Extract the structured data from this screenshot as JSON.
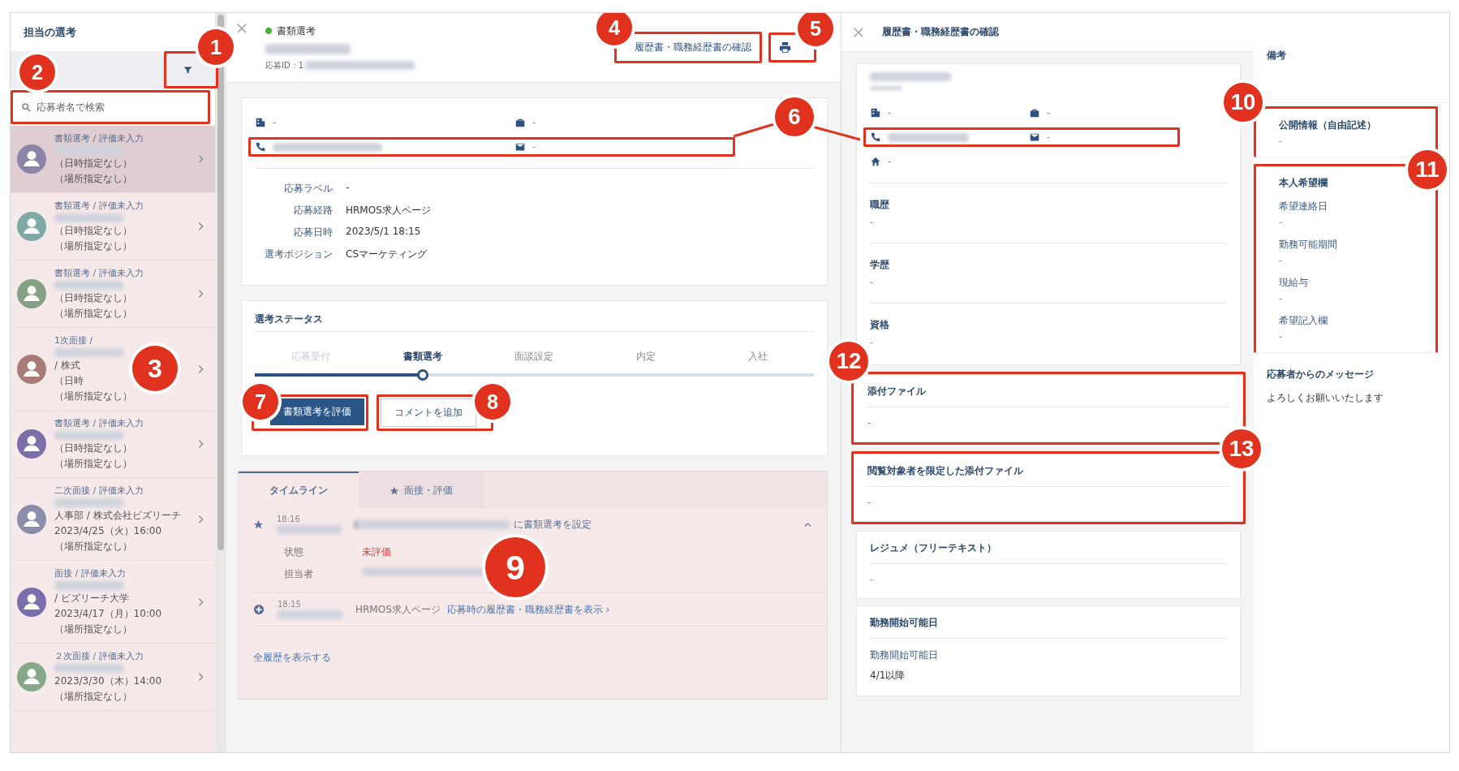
{
  "sidebar": {
    "title": "担当の選考",
    "search": {
      "placeholder": "応募者名で検索"
    },
    "items": [
      {
        "status": "書類選考 / 評価未入力",
        "lines": [
          "（日時指定なし）",
          "（場所指定なし）"
        ],
        "color": "#8a84a6",
        "selected": true
      },
      {
        "status": "書類選考 / 評価未入力",
        "lines": [
          "（日時指定なし）",
          "（場所指定なし）"
        ],
        "color": "#7fa9a6",
        "selected": false
      },
      {
        "status": "書類選考 / 評価未入力",
        "lines": [
          "（日時指定なし）",
          "（場所指定なし）"
        ],
        "color": "#86a083",
        "selected": false
      },
      {
        "status": "1次面接 /",
        "lines": [
          "/ 株式",
          "（日時",
          "（場所指定なし）"
        ],
        "color": "#a87b78",
        "selected": false
      },
      {
        "status": "書類選考 / 評価未入力",
        "lines": [
          "（日時指定なし）",
          "（場所指定なし）"
        ],
        "color": "#7c6fa8",
        "selected": false
      },
      {
        "status": "二次面接 / 評価未入力",
        "lines": [
          "人事部 / 株式会社ビズリーチ",
          "2023/4/25（火）16:00",
          "（場所指定なし）"
        ],
        "color": "#8a8ea8",
        "selected": false
      },
      {
        "status": "面接 / 評価未入力",
        "lines": [
          "/ ビズリーチ大学",
          "2023/4/17（月）10:00",
          "（場所指定なし）"
        ],
        "color": "#7a6eac",
        "selected": false
      },
      {
        "status": "２次面接 / 評価未入力",
        "lines": [
          "2023/3/30（木）14:00",
          "（場所指定なし）"
        ],
        "color": "#86a888",
        "selected": false
      }
    ]
  },
  "applicant": {
    "stage": "書類選考",
    "id_label": "応募ID：1",
    "resume_button": "履歴書・職務経歴書の確認",
    "contact": [
      {
        "kind": "building",
        "value": "-"
      },
      {
        "kind": "bag",
        "value": "-"
      },
      {
        "kind": "phone"
      },
      {
        "kind": "mail",
        "value": "-"
      }
    ],
    "details": [
      {
        "label": "応募ラベル",
        "value": "-"
      },
      {
        "label": "応募経路",
        "value": "HRMOS求人ページ"
      },
      {
        "label": "応募日時",
        "value": "2023/5/1 18:15"
      },
      {
        "label": "選考ポジション",
        "value": "CSマーケティング"
      }
    ],
    "status": {
      "title": "選考ステータス",
      "steps": [
        {
          "label": "応募受付",
          "selected": false
        },
        {
          "label": "書類選考",
          "selected": true
        },
        {
          "label": "面談設定",
          "selected": false
        },
        {
          "label": "内定",
          "selected": false
        },
        {
          "label": "入社",
          "selected": false
        }
      ],
      "actions": [
        {
          "label": "書類選考を評価",
          "kind": "primary"
        },
        {
          "label": "コメントを追加",
          "kind": "secondary"
        }
      ]
    },
    "timeline": {
      "tabs": [
        {
          "label": "タイムライン",
          "selected": true
        },
        {
          "label": "面接・評価",
          "selected": false
        }
      ],
      "entries": [
        {
          "kind": "star",
          "time": "18:16",
          "text": "に書類選考を設定",
          "expanded": true,
          "details": [
            {
              "label": "状態",
              "value": "未評価",
              "kind": "status"
            },
            {
              "label": "担当者"
            }
          ]
        },
        {
          "kind": "plus",
          "time": "18:15",
          "source": "HRMOS求人ページ",
          "link": "応募時の履歴書・職務経歴書を表示 ›"
        }
      ],
      "more": "全履歴を表示する"
    }
  },
  "resume": {
    "title": "履歴書・職務経歴書の確認",
    "contact": [
      {
        "kind": "building",
        "value": "-"
      },
      {
        "kind": "bag",
        "value": "-"
      },
      {
        "kind": "phone"
      },
      {
        "kind": "mail",
        "value": "-"
      },
      {
        "kind": "home",
        "value": "-"
      }
    ],
    "sections": [
      {
        "title": "職歴",
        "value": "-"
      },
      {
        "title": "学歴",
        "value": "-"
      },
      {
        "title": "資格",
        "value": "-"
      }
    ],
    "cards": [
      {
        "title": "添付ファイル",
        "value": "-"
      },
      {
        "title": "閲覧対象者を限定した添付ファイル",
        "value": "-"
      },
      {
        "title": "レジュメ（フリーテキスト）",
        "value": "-"
      },
      {
        "title": "勤務開始可能日",
        "fields": [
          {
            "label": "勤務開始可能日",
            "value": "4/1以降"
          }
        ]
      }
    ]
  },
  "notes": {
    "sections": [
      {
        "title": "備考"
      },
      {
        "title": "公開情報（自由記述）",
        "value": "-"
      },
      {
        "title": "本人希望欄",
        "fields": [
          {
            "label": "希望連絡日",
            "value": "-"
          },
          {
            "label": "勤務可能期間",
            "value": "-"
          },
          {
            "label": "現給与",
            "value": "-"
          },
          {
            "label": "希望記入欄",
            "value": "-"
          }
        ]
      },
      {
        "title": "応募者からのメッセージ",
        "text": "よろしくお願いいたします"
      }
    ]
  },
  "callouts": [
    "1",
    "2",
    "3",
    "4",
    "5",
    "6",
    "7",
    "8",
    "9",
    "10",
    "11",
    "12",
    "13"
  ]
}
